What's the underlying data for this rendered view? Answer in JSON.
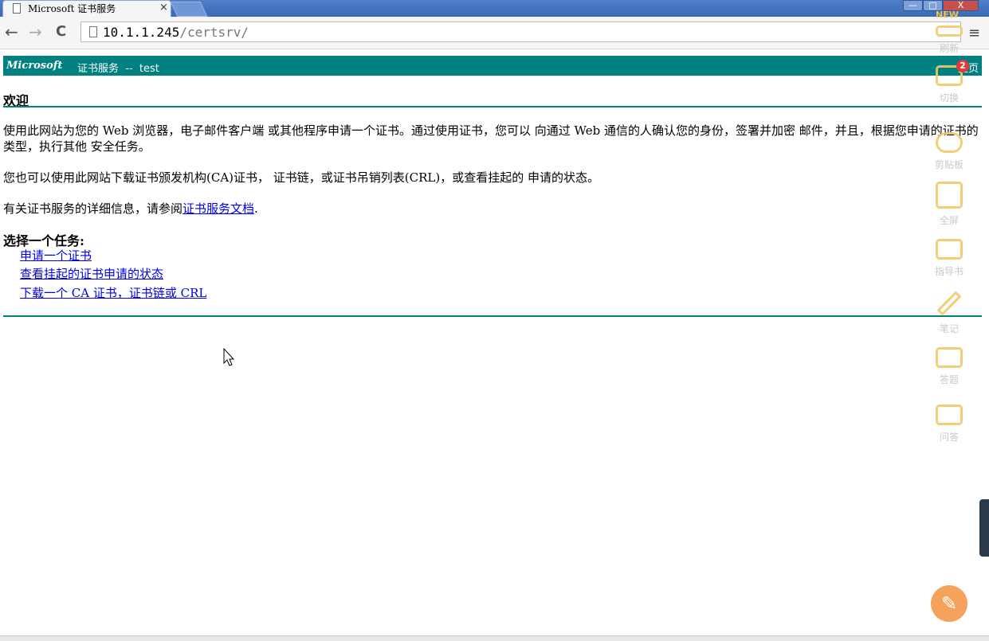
{
  "browser": {
    "tab_title": "Microsoft 证书服务",
    "tab_close": "×",
    "back": "←",
    "forward": "→",
    "reload": "C",
    "url_host": "10.1.1.245",
    "url_path": "/certsrv/",
    "menu": "≡",
    "window_min": "—",
    "window_max": "□",
    "window_close": "X"
  },
  "page": {
    "banner_brand": "Microsoft",
    "banner_service": "证书服务  --  test",
    "banner_home": "主页",
    "welcome_heading": "欢迎",
    "paragraph1": "使用此网站为您的 Web 浏览器，电子邮件客户端 或其他程序申请一个证书。通过使用证书，您可以 向通过 Web 通信的人确认您的身份，签署并加密 邮件，并且，根据您申请的证书的类型，执行其他 安全任务。",
    "paragraph2": "您也可以使用此网站下载证书颁发机构(CA)证书， 证书链，或证书吊销列表(CRL)，或查看挂起的 申请的状态。",
    "paragraph3_prefix": "有关证书服务的详细信息，请参阅",
    "paragraph3_link": "证书服务文档",
    "paragraph3_suffix": ".",
    "tasks_heading": "选择一个任务:",
    "tasks": [
      {
        "label": "申请一个证书"
      },
      {
        "label": "查看挂起的证书申请的状态"
      },
      {
        "label": "下载一个 CA 证书，证书链或 CRL"
      }
    ]
  },
  "overlay": {
    "new_badge": "NEW",
    "notification_count": "2",
    "items": [
      {
        "label": "刷新",
        "icon": "refresh-icon"
      },
      {
        "label": "切换",
        "icon": "switch-icon"
      },
      {
        "label": "剪贴板",
        "icon": "clipboard-icon"
      },
      {
        "label": "全屏",
        "icon": "fullscreen-icon"
      },
      {
        "label": "指导书",
        "icon": "guide-book-icon"
      },
      {
        "label": "笔记",
        "icon": "pencil-icon"
      },
      {
        "label": "答题",
        "icon": "answer-icon"
      },
      {
        "label": "问答",
        "icon": "qa-icon"
      }
    ],
    "tool_icon": "wrench-icon"
  },
  "colors": {
    "banner": "#008080",
    "link": "#0000ee",
    "titlebar": "#3b6ab6",
    "overlay_icon": "#f2c96a"
  }
}
